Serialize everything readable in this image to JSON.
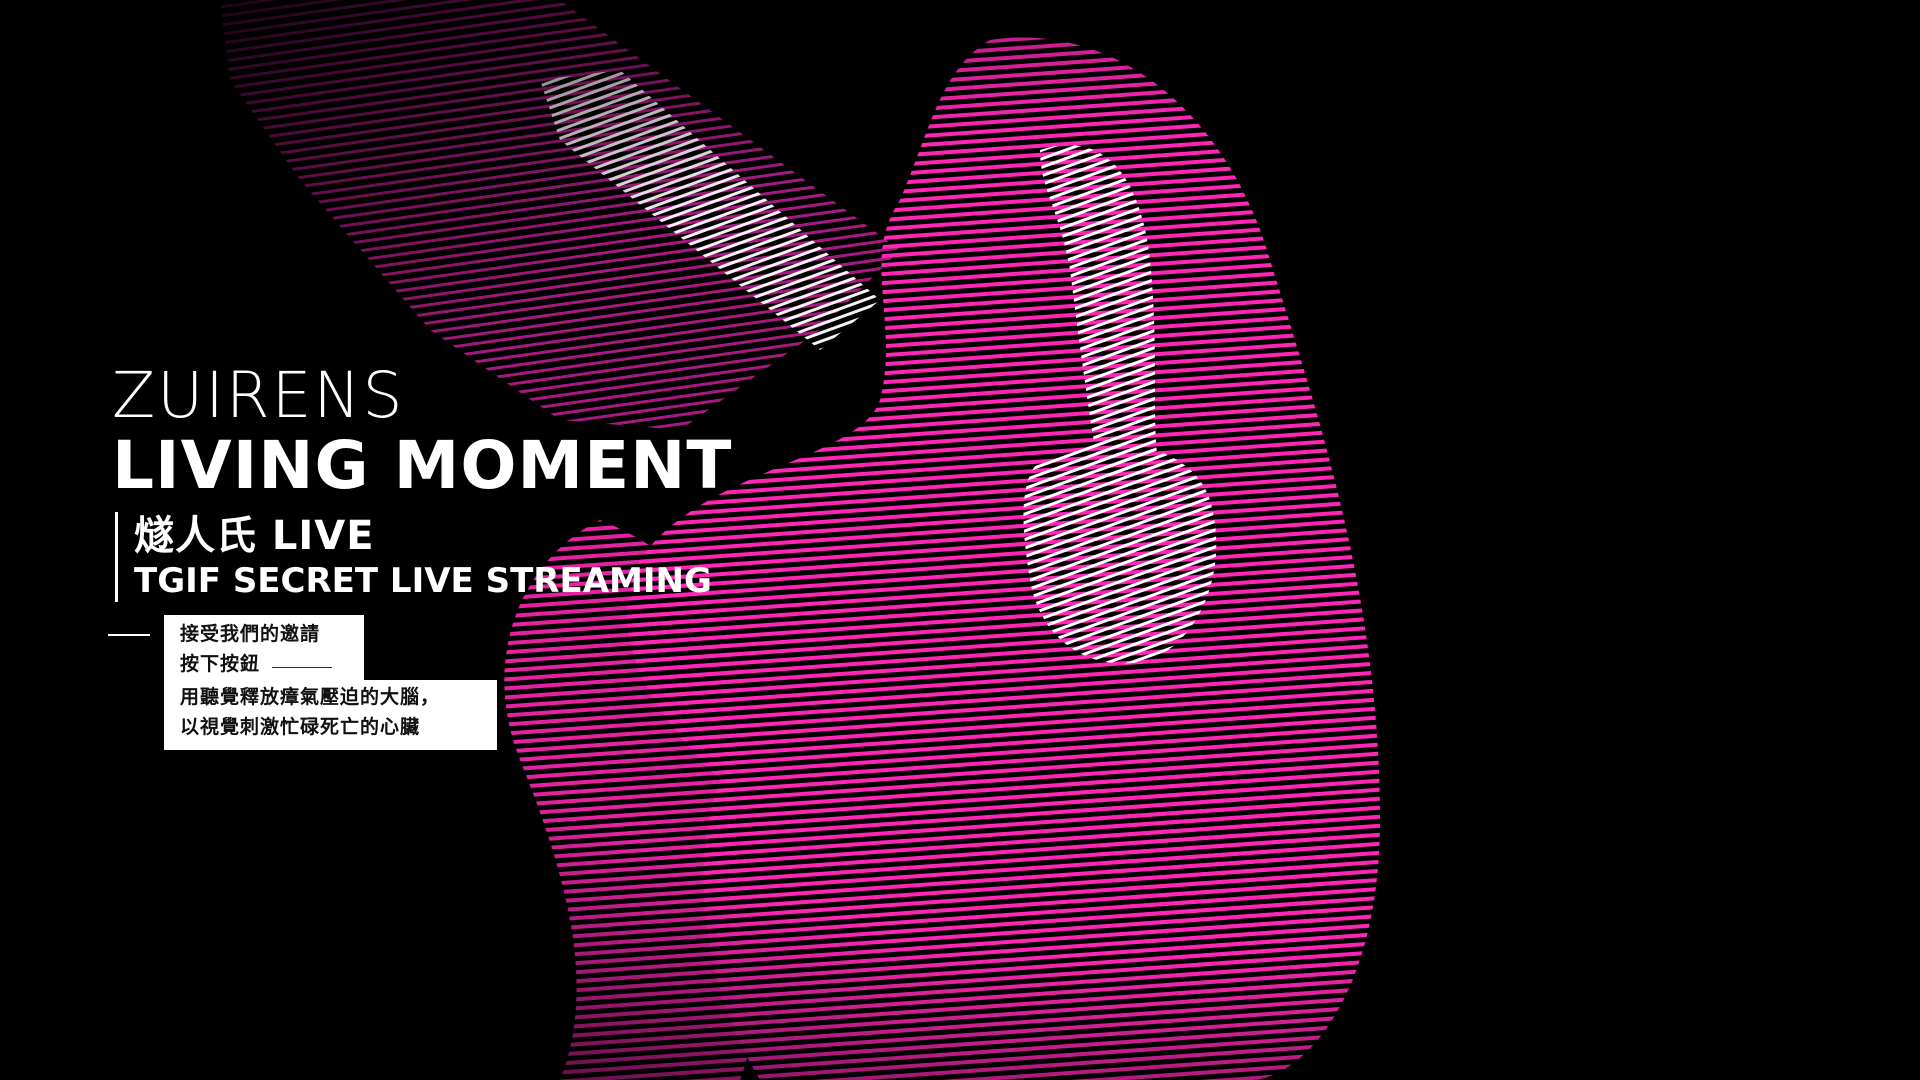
{
  "title": {
    "line1": "ZUIRENS",
    "line2": "LIVING MOMENT"
  },
  "subtitle": {
    "zh": "燧人氏 LIVE",
    "en": "TGIF SECRET LIVE STREAMING"
  },
  "invite": {
    "lines": [
      "接受我們的邀請",
      "按下按鈕",
      "用聽覺釋放瘴氣壓迫的大腦，",
      "以視覺刺激忙碌死亡的心臟"
    ]
  },
  "colors": {
    "background": "#000000",
    "accent": "#ff2bb8",
    "text": "#ffffff"
  },
  "artwork": {
    "subject": "pink horizontal-line scan figure wearing headphones"
  }
}
